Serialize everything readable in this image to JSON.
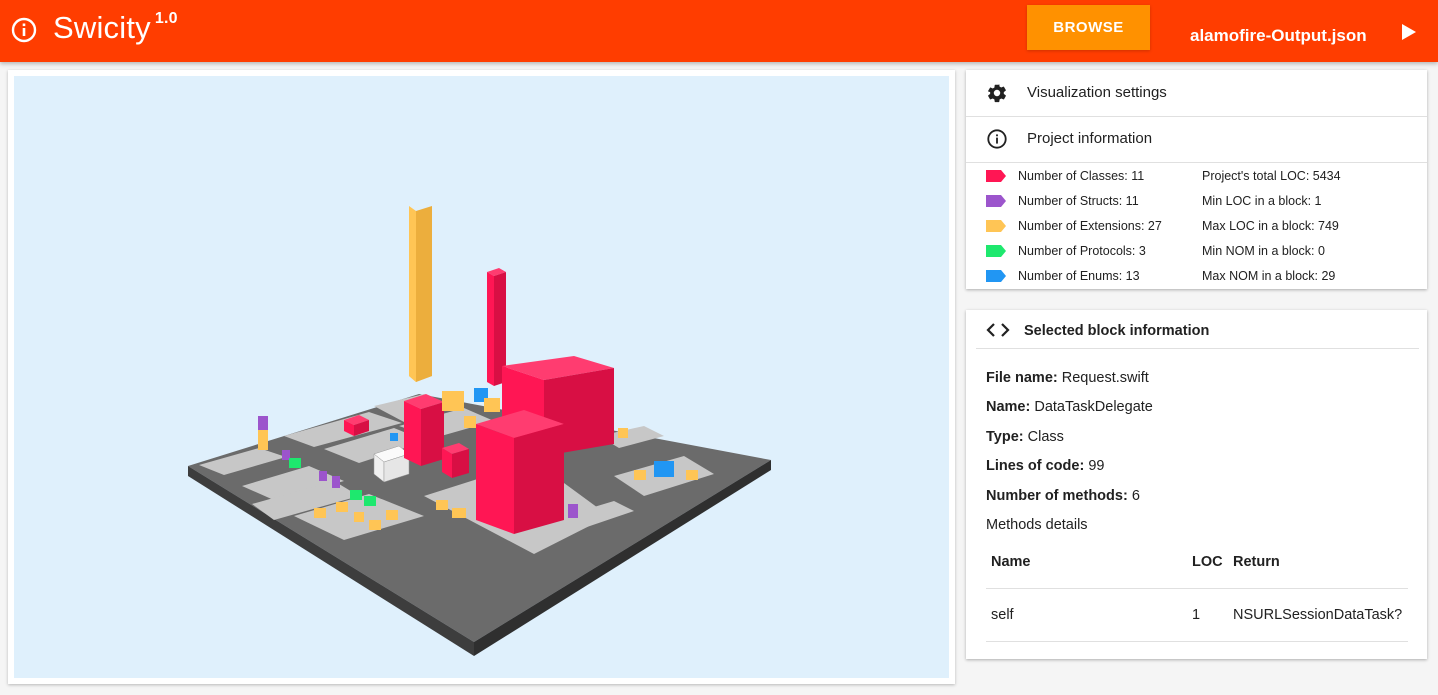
{
  "app": {
    "title": "Swicity",
    "version": "1.0",
    "browse_label": "BROWSE",
    "filename": "alamofire-Output.json",
    "accent_color": "#ff3d00",
    "button_color": "#ff9100"
  },
  "panels": {
    "settings_label": "Visualization settings",
    "project_label": "Project information",
    "selected_label": "Selected block information"
  },
  "legend": [
    {
      "label": "Number of Classes: 11",
      "color": "#ff1654"
    },
    {
      "label": "Number of Structs: 11",
      "color": "#9c55cc"
    },
    {
      "label": "Number of Extensions: 27",
      "color": "#ffc555"
    },
    {
      "label": "Number of Protocols: 3",
      "color": "#1ee86e"
    },
    {
      "label": "Number of Enums: 13",
      "color": "#2196f3"
    }
  ],
  "stats": [
    "Project's total LOC: 5434",
    "Min LOC in a block: 1",
    "Max LOC in a block: 749",
    "Min NOM in a block: 0",
    "Max NOM in a block: 29"
  ],
  "selected": {
    "file_name_label": "File name:",
    "file_name": "Request.swift",
    "name_label": "Name:",
    "name": "DataTaskDelegate",
    "type_label": "Type:",
    "type": "Class",
    "loc_label": "Lines of code:",
    "loc": "99",
    "nom_label": "Number of methods:",
    "nom": "6",
    "methods_details": "Methods details",
    "table": {
      "headers": [
        "Name",
        "LOC",
        "Return"
      ],
      "rows": [
        [
          "self",
          "1",
          "NSURLSessionDataTask?"
        ]
      ]
    }
  }
}
